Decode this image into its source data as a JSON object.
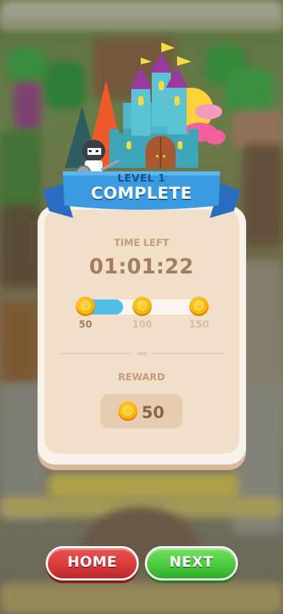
{
  "level": {
    "title": "LEVEL 1",
    "status": "COMPLETE"
  },
  "time": {
    "label": "TIME LEFT",
    "value": "01:01:22"
  },
  "progress": {
    "fraction": 0.25,
    "milestones": [
      {
        "value": "50",
        "reached": true
      },
      {
        "value": "100",
        "reached": false
      },
      {
        "value": "150",
        "reached": false
      }
    ]
  },
  "reward": {
    "label": "REWARD",
    "amount": "50"
  },
  "buttons": {
    "home": "HOME",
    "next": "NEXT"
  },
  "colors": {
    "ribbon": "#3b9be0",
    "progress_fill": "#4fbde8",
    "home_button": "#d83b3a",
    "next_button": "#49c83b",
    "milestone_reached": "#a47c62",
    "milestone_pending": "#d6bda6"
  },
  "icons": [
    "castle-icon",
    "knight-icon",
    "coin-icon"
  ]
}
